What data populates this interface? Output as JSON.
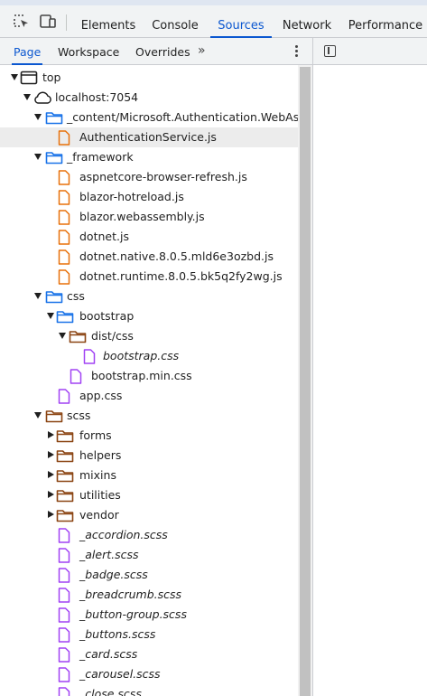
{
  "toolbar": {
    "tabs": [
      {
        "label": "Elements"
      },
      {
        "label": "Console"
      },
      {
        "label": "Sources"
      },
      {
        "label": "Network"
      },
      {
        "label": "Performance"
      }
    ],
    "active_tab": "Sources"
  },
  "navigator": {
    "tabs": [
      {
        "label": "Page"
      },
      {
        "label": "Workspace"
      },
      {
        "label": "Overrides"
      }
    ],
    "more_label": "»",
    "active_tab": "Page"
  },
  "tree": [
    {
      "label": "top",
      "type": "frame",
      "expanded": true,
      "italic": false
    },
    {
      "label": "localhost:7054",
      "type": "cloud",
      "expanded": true,
      "italic": false
    },
    {
      "label": "_content/Microsoft.Authentication.WebAsse",
      "type": "folder-blue",
      "expanded": true,
      "italic": false
    },
    {
      "label": "AuthenticationService.js",
      "type": "file-js",
      "selected": true,
      "italic": false
    },
    {
      "label": "_framework",
      "type": "folder-blue",
      "expanded": true,
      "italic": false
    },
    {
      "label": "aspnetcore-browser-refresh.js",
      "type": "file-js",
      "italic": false
    },
    {
      "label": "blazor-hotreload.js",
      "type": "file-js",
      "italic": false
    },
    {
      "label": "blazor.webassembly.js",
      "type": "file-js",
      "italic": false
    },
    {
      "label": "dotnet.js",
      "type": "file-js",
      "italic": false
    },
    {
      "label": "dotnet.native.8.0.5.mld6e3ozbd.js",
      "type": "file-js",
      "italic": false
    },
    {
      "label": "dotnet.runtime.8.0.5.bk5q2fy2wg.js",
      "type": "file-js",
      "italic": false
    },
    {
      "label": "css",
      "type": "folder-blue",
      "expanded": true,
      "italic": false
    },
    {
      "label": "bootstrap",
      "type": "folder-blue",
      "expanded": true,
      "italic": false
    },
    {
      "label": "dist/css",
      "type": "folder-brown",
      "expanded": true,
      "italic": false
    },
    {
      "label": "bootstrap.css",
      "type": "file-css",
      "italic": true
    },
    {
      "label": "bootstrap.min.css",
      "type": "file-css",
      "italic": false
    },
    {
      "label": "app.css",
      "type": "file-css",
      "italic": false
    },
    {
      "label": "scss",
      "type": "folder-brown",
      "expanded": true,
      "italic": false
    },
    {
      "label": "forms",
      "type": "folder-brown",
      "expanded": false,
      "italic": false
    },
    {
      "label": "helpers",
      "type": "folder-brown",
      "expanded": false,
      "italic": false
    },
    {
      "label": "mixins",
      "type": "folder-brown",
      "expanded": false,
      "italic": false
    },
    {
      "label": "utilities",
      "type": "folder-brown",
      "expanded": false,
      "italic": false
    },
    {
      "label": "vendor",
      "type": "folder-brown",
      "expanded": false,
      "italic": false
    },
    {
      "label": "_accordion.scss",
      "type": "file-css",
      "italic": true
    },
    {
      "label": "_alert.scss",
      "type": "file-css",
      "italic": true
    },
    {
      "label": "_badge.scss",
      "type": "file-css",
      "italic": true
    },
    {
      "label": "_breadcrumb.scss",
      "type": "file-css",
      "italic": true
    },
    {
      "label": "_button-group.scss",
      "type": "file-css",
      "italic": true
    },
    {
      "label": "_buttons.scss",
      "type": "file-css",
      "italic": true
    },
    {
      "label": "_card.scss",
      "type": "file-css",
      "italic": true
    },
    {
      "label": "_carousel.scss",
      "type": "file-css",
      "italic": true
    },
    {
      "label": "_close.scss",
      "type": "file-css",
      "italic": true
    }
  ],
  "colors": {
    "accent": "#0b57d0",
    "folder_blue": "#1a73e8",
    "folder_brown": "#8b4513",
    "file_js": "#e8710a",
    "file_css": "#a142f4",
    "selected_row": "#ececec"
  },
  "icons": {
    "inspect": "inspect-element-icon",
    "device": "device-toolbar-icon",
    "more_menu": "kebab-menu-icon",
    "toggle_panel": "toggle-sidebar-icon"
  }
}
